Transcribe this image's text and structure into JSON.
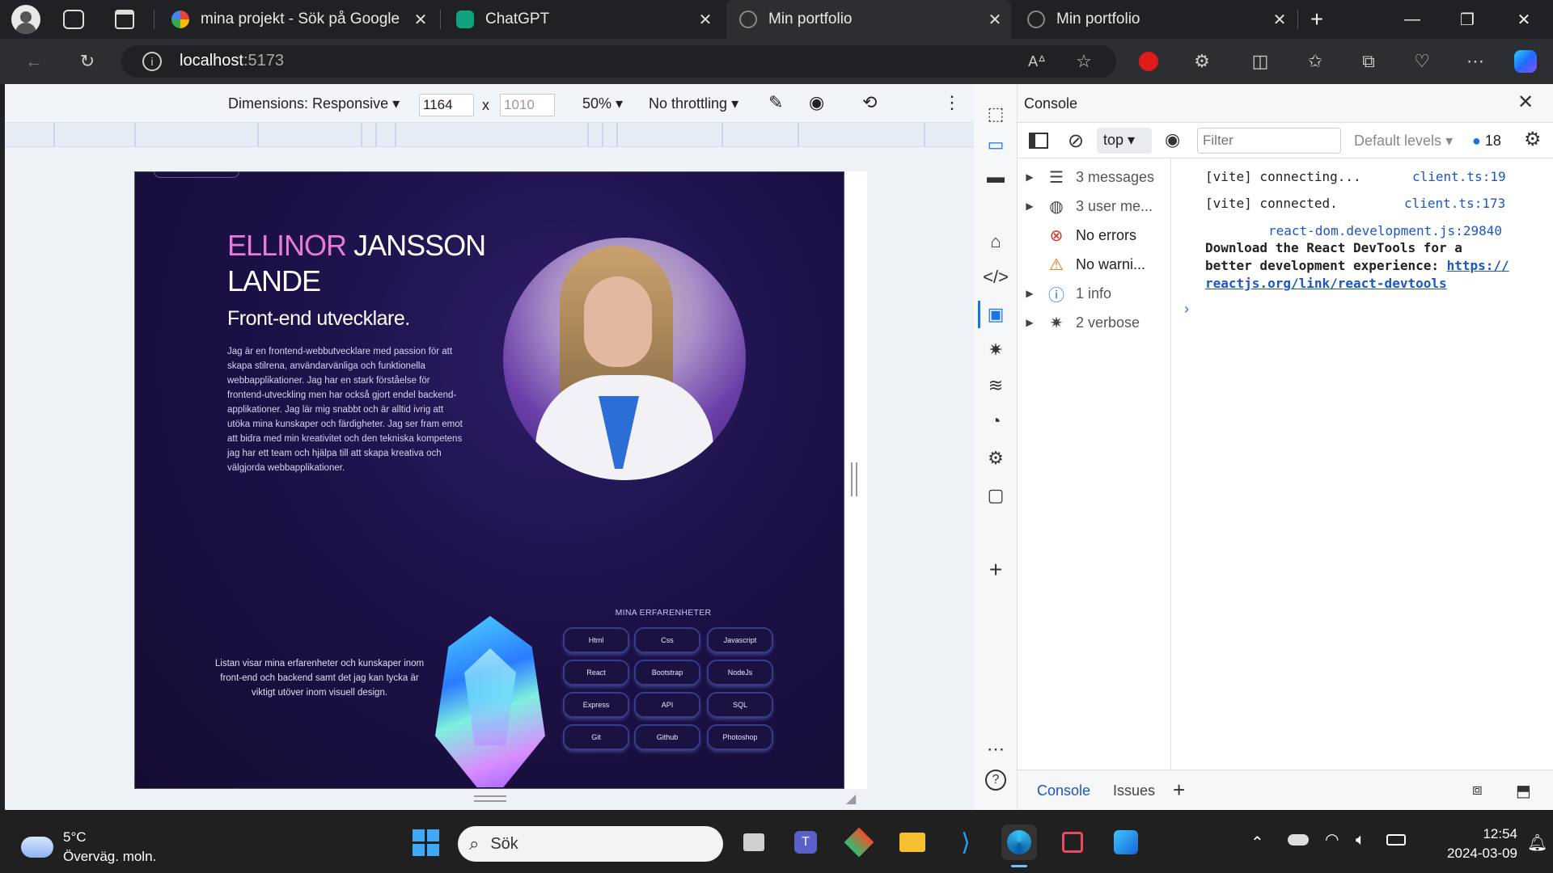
{
  "tabs": [
    {
      "label": "mina projekt - Sök på Google",
      "icon": "google-icon"
    },
    {
      "label": "ChatGPT",
      "icon": "chatgpt-icon"
    },
    {
      "label": "Min portfolio",
      "icon": "portfolio-icon",
      "active": true
    },
    {
      "label": "Min portfolio",
      "icon": "portfolio-icon"
    }
  ],
  "address": {
    "host": "localhost",
    "port": ":5173"
  },
  "device": {
    "dimensions": "Dimensions: Responsive",
    "width": "1164",
    "x": "x",
    "height": "1010",
    "zoom": "50%",
    "throttling": "No throttling"
  },
  "portfolio": {
    "name_first": "ELLINOR",
    "name_rest": "JANSSON",
    "name_last": "LANDE",
    "role": "Front-end utvecklare.",
    "bio": "Jag är en frontend-webbutvecklare med passion för att skapa stilrena, användarvänliga och funktionella webbapplikationer. Jag har en stark förståelse för frontend-utveckling men har också gjort endel backend-applikationer. Jag lär mig snabbt och är alltid ivrig att utöka mina kunskaper och färdigheter. Jag ser fram emot att bidra med min kreativitet och den tekniska kompetens jag har ett team och hjälpa till att skapa kreativa och välgjorda webbapplikationer.",
    "skills_title": "MINA ERFARENHETER",
    "skills_text": "Listan visar mina erfarenheter och kunskaper inom front-end och backend samt det jag kan tycka är viktigt utöver inom visuell design.",
    "skills": [
      "Html",
      "Css",
      "Javascript",
      "React",
      "Bootstrap",
      "NodeJs",
      "Express",
      "API",
      "SQL",
      "Git",
      "Github",
      "Photoshop"
    ]
  },
  "devtools": {
    "title": "Console",
    "context": "top",
    "filter_placeholder": "Filter",
    "levels": "Default levels",
    "issue_count": "18",
    "sidebar": [
      {
        "label": "3 messages",
        "icon": "list-icon",
        "expandable": true
      },
      {
        "label": "3 user me...",
        "icon": "user-icon",
        "expandable": true
      },
      {
        "label": "No errors",
        "icon": "error-icon",
        "expandable": false
      },
      {
        "label": "No warni...",
        "icon": "warning-icon",
        "expandable": false
      },
      {
        "label": "1 info",
        "icon": "info-icon",
        "expandable": true
      },
      {
        "label": "2 verbose",
        "icon": "bug-icon",
        "expandable": true
      }
    ],
    "messages": [
      {
        "text": "[vite] connecting...",
        "source": "client.ts:19"
      },
      {
        "text": "[vite] connected.",
        "source": "client.ts:173"
      }
    ],
    "react_source": "react-dom.development.js:29840",
    "react_msg_1": "Download the React DevTools for a",
    "react_msg_2": "better development experience:",
    "react_link_1": "https://",
    "react_link_2": "reactjs.org/link/react-devtools",
    "bottom_tabs": [
      "Console",
      "Issues"
    ]
  },
  "taskbar": {
    "temp": "5°C",
    "weather": "Överväg. moln.",
    "search": "Sök",
    "time": "12:54",
    "date": "2024-03-09"
  }
}
